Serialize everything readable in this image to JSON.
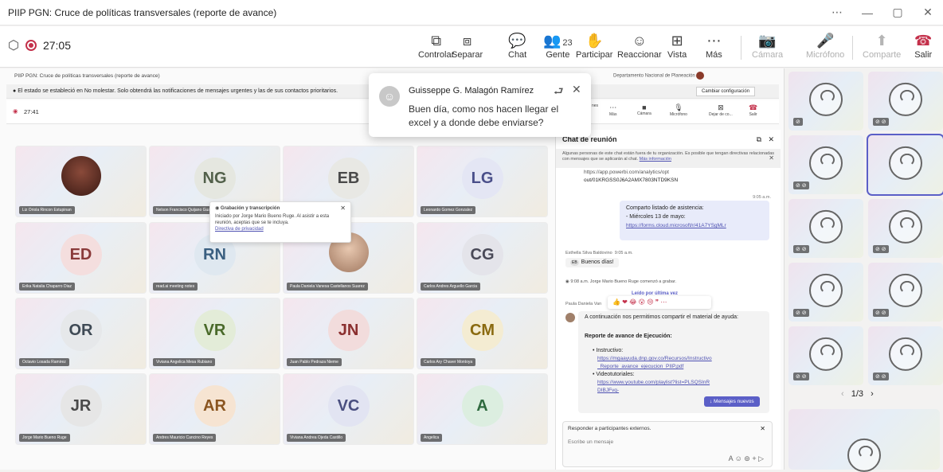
{
  "window": {
    "title": "PIIP PGN: Cruce de políticas transversales (reporte de avance)",
    "controls": [
      "⋯",
      "—",
      "▢",
      "✕"
    ]
  },
  "toolbar": {
    "timer": "27:05",
    "buttons": [
      {
        "icon": "control-icon",
        "glyph": "⧉",
        "label": "Controlar"
      },
      {
        "icon": "popout-icon",
        "glyph": "⧈",
        "label": "Separar"
      },
      {
        "icon": "chat-icon",
        "glyph": "💬",
        "label": "Chat"
      },
      {
        "icon": "people-icon",
        "glyph": "👥",
        "label": "Gente",
        "count": "23"
      },
      {
        "icon": "raise-hand-icon",
        "glyph": "✋",
        "label": "Participar"
      },
      {
        "icon": "react-icon",
        "glyph": "☺",
        "label": "Reaccionar"
      },
      {
        "icon": "view-icon",
        "glyph": "⊞",
        "label": "Vista"
      },
      {
        "icon": "more-icon",
        "glyph": "⋯",
        "label": "Más"
      },
      {
        "icon": "camera-icon",
        "glyph": "📷",
        "label": "Cámara"
      },
      {
        "icon": "mic-icon",
        "glyph": "🎤",
        "label": "Micrófono"
      },
      {
        "icon": "share-icon",
        "glyph": "⬆",
        "label": "Comparte"
      },
      {
        "icon": "leave-icon",
        "glyph": "☎",
        "label": "Salir"
      }
    ]
  },
  "inner": {
    "title": "PIIP PGN: Cruce de políticas transversales (reporte de avance)",
    "org": "Departamento Nacional de Planeación",
    "notice": "El estado se estableció en No molestar. Solo obtendrá las notificaciones de mensajes urgentes y las de sus contactos prioritarios.",
    "notice_button": "Cambiar configuración",
    "timer": "27:41",
    "buttons": [
      "nes",
      "Más",
      "Cámara",
      "Micrófono",
      "Dejar de co...",
      "Salir"
    ]
  },
  "rec_popup": {
    "title": "Grabación y transcripción",
    "body": "Iniciado por Jorge Mario Bueno Ruge. Al asistir a esta reunión, aceptas que se te incluya.",
    "link": "Directiva de privacidad"
  },
  "tiles": [
    {
      "initials": "",
      "name": "Liz Oriola Rincon Estupinan",
      "bg": "",
      "fg": "",
      "photo": true
    },
    {
      "initials": "NG",
      "name": "Nelson Francisco Quijano Guamizo",
      "bg": "#e5e7e0",
      "fg": "#52604a"
    },
    {
      "initials": "EB",
      "name": "Esthella Silva Baldovino",
      "bg": "#e8e8e4",
      "fg": "#4a4a4a"
    },
    {
      "initials": "LG",
      "name": "Leonardo Gomez Gonzalez",
      "bg": "#e4e6f4",
      "fg": "#4a4f8a"
    },
    {
      "initials": "ED",
      "name": "Erika Natalia Chaparro Diaz",
      "bg": "#f4dede",
      "fg": "#8a3a3a"
    },
    {
      "initials": "RN",
      "name": "read.ai meeting notes",
      "bg": "#dfe8f0",
      "fg": "#3a5f80"
    },
    {
      "initials": "",
      "name": "Paula Daniela Vanesa Castellanos Suarez",
      "bg": "",
      "fg": "",
      "photo": true
    },
    {
      "initials": "CG",
      "name": "Carlos Andres Arguello Garcia",
      "bg": "#e4e4ea",
      "fg": "#4a4a58"
    },
    {
      "initials": "OR",
      "name": "Octavio Losada Ramirez",
      "bg": "#e6e8ea",
      "fg": "#3f4a55"
    },
    {
      "initials": "VR",
      "name": "Viviana Angelica Mesa Rubiano",
      "bg": "#e3ecd8",
      "fg": "#4a6a2a"
    },
    {
      "initials": "JN",
      "name": "Juan Pablo Pedraza Nieme",
      "bg": "#f2dcdc",
      "fg": "#8a2f2f"
    },
    {
      "initials": "CM",
      "name": "Carlos Ary Chaver Montoya",
      "bg": "#f4ecd2",
      "fg": "#8a6a10"
    },
    {
      "initials": "JR",
      "name": "Jorge Mario Bueno Ruge",
      "bg": "#e6e6e6",
      "fg": "#4a4a4a"
    },
    {
      "initials": "AR",
      "name": "Andres Mauricio Cancino Reyes",
      "bg": "#f6e4d2",
      "fg": "#8a5520"
    },
    {
      "initials": "VC",
      "name": "Viviana Andrea Ojeda Castillo",
      "bg": "#e2e4f2",
      "fg": "#4a4f80"
    },
    {
      "initials": "A",
      "name": "Angelica",
      "bg": "#dceee0",
      "fg": "#2f6a3f"
    }
  ],
  "toast": {
    "name": "Guisseppe G. Malagón Ramírez",
    "message": "Buen día, como nos hacen llegar el excel y a donde debe enviarse?"
  },
  "chat": {
    "title": "Chat de reunión",
    "external_notice": "Algunas personas de este chat están fuera de tu organización. Es posible que tengan directivas relacionadas con mensajes que se aplicarán al chat.",
    "more_info": "Más información",
    "link_tail_1": "https://app.powerbi.com/analytics/opt",
    "link_tail_2": "out/01KRGSS0J6A2AMX7803NTD9KSN",
    "time_905": "9:05 a.m.",
    "own_line1": "Comparto listado de asistencia:",
    "own_line2": "- Miércoles 13 de mayo:",
    "own_link": "https://forms.cloud.microsoft/r/41A7YSgMLr",
    "eb_author": "Esthella Silva Baldovino",
    "eb_time": "9:05 a.m.",
    "eb_initials": "EB",
    "eb_msg": "Buenos días!",
    "rec_event": "9:08 a.m.   Jorge Mario Bueno Ruge comenzó a grabar.",
    "read_last": "Leído por última vez",
    "paula_author": "Paula Daniela Van",
    "p_msg": "A continuación nos permitimos compartir el material de ayuda:",
    "p_heading": "Reporte de avance de Ejecución:",
    "p_b1": "Instructivo:",
    "p_link1": "https://mgaayuda.dnp.gov.co/Recursos/Instructivo_Reporte_avance_ejecucion_PIIP.pdf",
    "p_b2": "Videotutoriales:",
    "p_link2": "https://www.youtube.com/playlist?list=PLSQSInRDIBJFvq-",
    "new_messages": "↓  Mensajes nuevos",
    "reply_label": "Responder a participantes externos.",
    "compose_placeholder": "Escribe un mensaje"
  },
  "pager": "1/3"
}
